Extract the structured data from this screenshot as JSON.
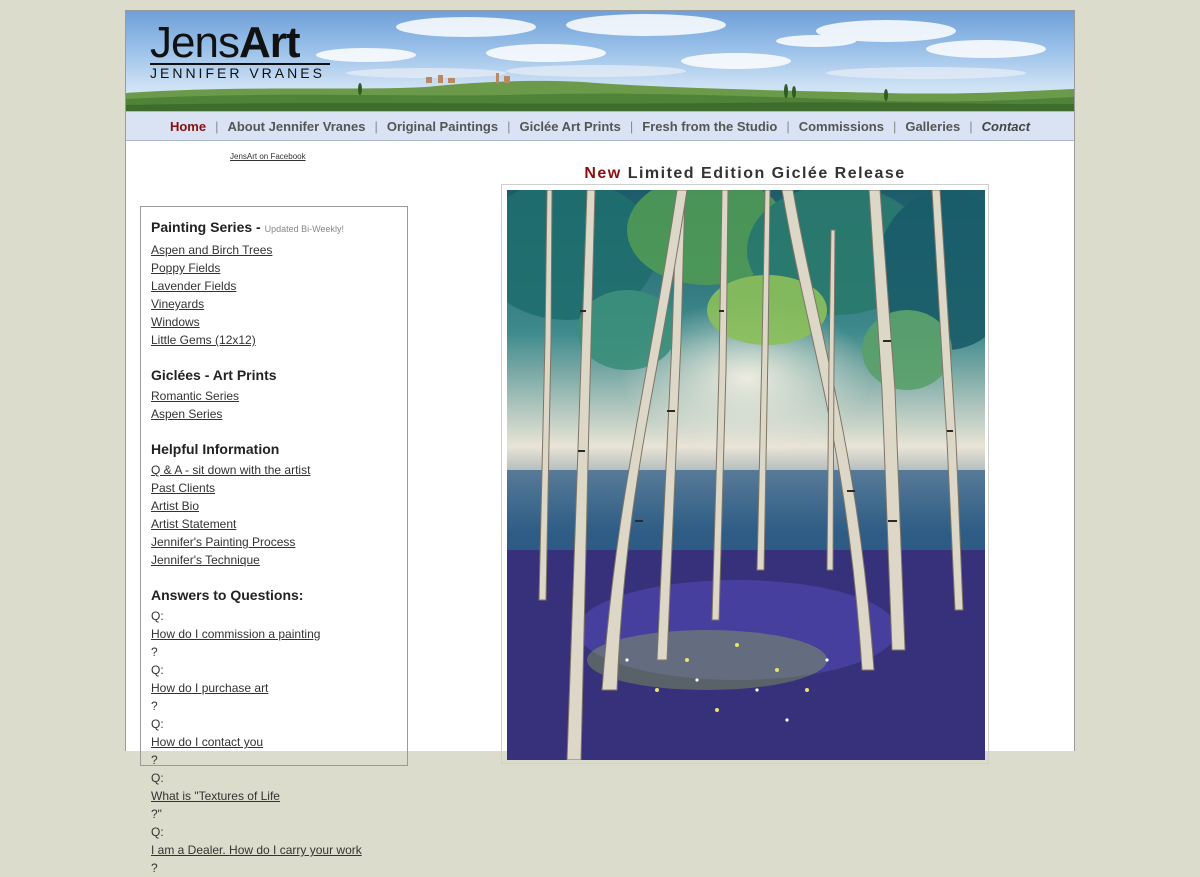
{
  "logo": {
    "word_light": "Jens",
    "word_bold": "Art",
    "subtitle": "JENNIFER VRANES"
  },
  "nav": {
    "items": [
      {
        "label": "Home"
      },
      {
        "label": "About Jennifer Vranes"
      },
      {
        "label": "Original Paintings"
      },
      {
        "label": "Giclée Art Prints"
      },
      {
        "label": "Fresh from the Studio"
      },
      {
        "label": "Commissions"
      },
      {
        "label": "Galleries"
      },
      {
        "label": "Contact"
      }
    ],
    "separator": "|"
  },
  "facebook_link": "JensArt on Facebook",
  "sidebar": {
    "painting_series": {
      "title": "Painting Series",
      "note": "Updated Bi-Weekly!",
      "links": [
        "Aspen and Birch Trees",
        "Poppy Fields",
        "Lavender Fields",
        "Vineyards",
        "Windows",
        "Little Gems (12x12)"
      ]
    },
    "giclees": {
      "title": "Giclées - Art Prints",
      "links": [
        "Romantic Series",
        "Aspen Series"
      ]
    },
    "helpful": {
      "title": "Helpful Information",
      "links": [
        "Q & A - sit down with the artist",
        "Past Clients",
        "Artist Bio",
        "Artist Statement",
        "Jennifer's Painting Process",
        "Jennifer's Technique"
      ]
    },
    "answers": {
      "title": "Answers to Questions:",
      "prefix": "Q:",
      "items": [
        {
          "link": "How do I commission a painting",
          "suffix": "?"
        },
        {
          "link": "How do I purchase art",
          "suffix": "?"
        },
        {
          "link": "How do I contact you",
          "suffix": "?"
        },
        {
          "link": "What is \"Textures of Life",
          "suffix": "?\""
        },
        {
          "link": "I am a Dealer.  How do I carry your work",
          "suffix": "?"
        }
      ]
    }
  },
  "feature": {
    "title_highlight": "New",
    "title_rest": "Limited Edition Giclée Release"
  },
  "colors": {
    "background": "#dcdccc",
    "nav_bg": "#d9e3f3",
    "accent_red": "#8a1010"
  }
}
